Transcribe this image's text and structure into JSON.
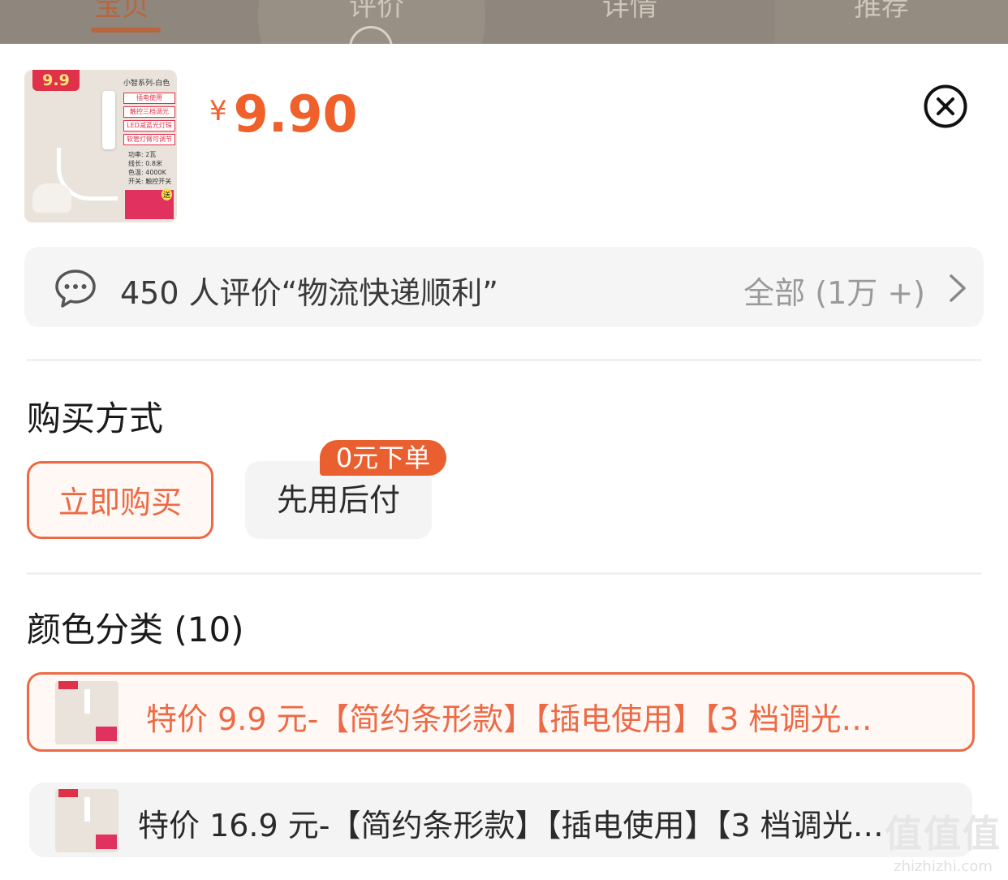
{
  "topnav": {
    "tabs": [
      {
        "label": "宝贝",
        "active": true
      },
      {
        "label": "评价",
        "active": false
      },
      {
        "label": "详情",
        "active": false
      },
      {
        "label": "推荐",
        "active": false
      }
    ]
  },
  "product": {
    "thumb": {
      "badge": "9.9",
      "title": "小智系列-白色",
      "chips": [
        "插电使用",
        "触控三档调光",
        "LED减蓝光灯珠",
        "软管灯臂可调节"
      ],
      "specs": [
        "功率: 2瓦",
        "线长: 0.8米",
        "色温: 4000K",
        "开关: 触控开关"
      ],
      "gift": "送"
    },
    "currency": "¥",
    "price": "9.90"
  },
  "close_icon": "close-circle-icon",
  "review": {
    "text": "450 人评价“物流快递顺利”",
    "all_label": "全部 (1万 +)"
  },
  "purchase": {
    "title": "购买方式",
    "options": [
      {
        "label": "立即购买",
        "selected": true
      },
      {
        "label": "先用后付",
        "selected": false,
        "tag": "0元下单"
      }
    ]
  },
  "colors": {
    "title": "颜色分类 (10)",
    "items": [
      {
        "label": "特价 9.9 元-【简约条形款】【插电使用】【3 档调光…",
        "selected": true
      },
      {
        "label": "特价 16.9 元-【简约条形款】【插电使用】【3 档调光…",
        "selected": false
      }
    ]
  },
  "watermark": {
    "big": "值值值",
    "small": "zhizhizhi.com"
  },
  "theme": {
    "accent": "#ec6a45",
    "price_color": "#f0602a"
  }
}
